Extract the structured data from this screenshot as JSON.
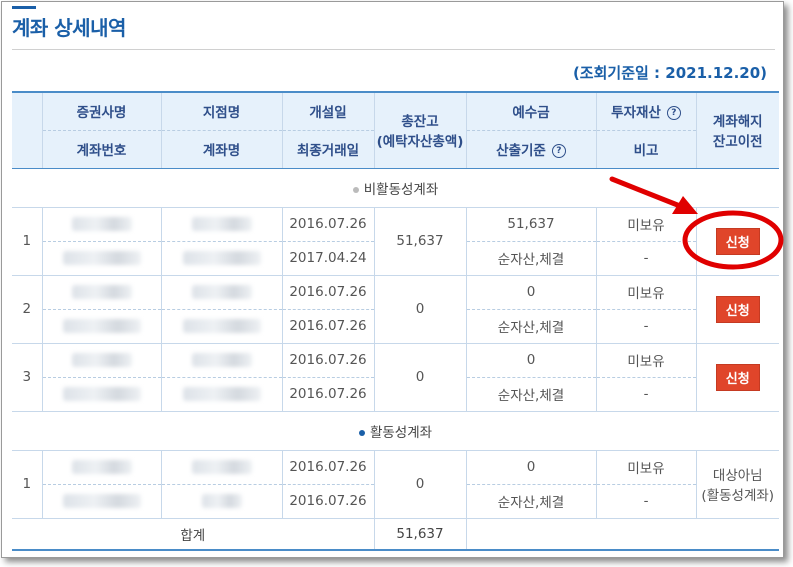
{
  "page": {
    "title": "계좌 상세내역",
    "inquiry_date": "(조회기준일 : 2021.12.20)"
  },
  "table": {
    "headers": {
      "firm": "증권사명",
      "account_no": "계좌번호",
      "branch": "지점명",
      "account_name": "계좌명",
      "open_date": "개설일",
      "last_trade_date": "최종거래일",
      "total_balance": "총잔고",
      "total_balance_sub": "(예탁자산총액)",
      "deposit": "예수금",
      "calc_basis": "산출기준",
      "investment": "투자재산",
      "remarks": "비고",
      "termination": "계좌해지",
      "balance_transfer": "잔고이전",
      "help": "?"
    },
    "inactive_section": {
      "label": "비활동성계좌",
      "rows": [
        {
          "no": "1",
          "open_date": "2016.07.26",
          "last_trade_date": "2017.04.24",
          "total": "51,637",
          "deposit": "51,637",
          "basis": "순자산,체결",
          "investment": "미보유",
          "remark": "-",
          "action": "신청"
        },
        {
          "no": "2",
          "open_date": "2016.07.26",
          "last_trade_date": "2016.07.26",
          "total": "0",
          "deposit": "0",
          "basis": "순자산,체결",
          "investment": "미보유",
          "remark": "-",
          "action": "신청"
        },
        {
          "no": "3",
          "open_date": "2016.07.26",
          "last_trade_date": "2016.07.26",
          "total": "0",
          "deposit": "0",
          "basis": "순자산,체결",
          "investment": "미보유",
          "remark": "-",
          "action": "신청"
        }
      ]
    },
    "active_section": {
      "label": "활동성계좌",
      "rows": [
        {
          "no": "1",
          "open_date": "2016.07.26",
          "last_trade_date": "2016.07.26",
          "total": "0",
          "deposit": "0",
          "basis": "순자산,체결",
          "investment": "미보유",
          "remark": "-",
          "action_line1": "대상아님",
          "action_line2": "(활동성계좌)"
        }
      ]
    },
    "total": {
      "label": "합계",
      "value": "51,637"
    }
  },
  "colors": {
    "accent": "#1a5fa8",
    "button": "#e0452a",
    "annotation": "#e00000"
  }
}
